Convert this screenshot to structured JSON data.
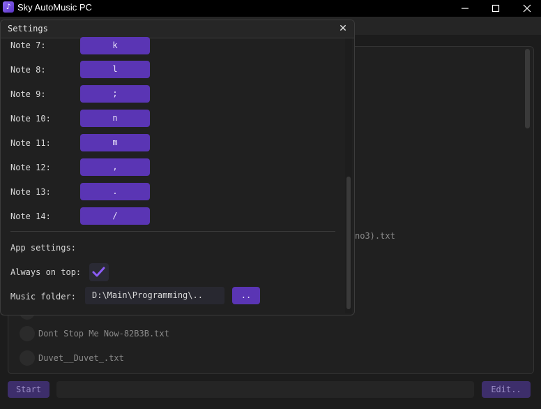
{
  "window": {
    "title": "Sky AutoMusic PC",
    "controls": [
      "minimize",
      "maximize",
      "close"
    ]
  },
  "background": {
    "partial_song_text": "no3).txt",
    "songs": [
      {
        "label": ""
      },
      {
        "label": "Dont Stop Me Now-82B3B.txt"
      },
      {
        "label": "Duvet__Duvet_.txt"
      }
    ],
    "start_label": "Start",
    "edit_label": "Edit.."
  },
  "settings": {
    "title": "Settings",
    "close_glyph": "✕",
    "notes": [
      {
        "label": "Note 7:",
        "key": "k"
      },
      {
        "label": "Note 8:",
        "key": "l"
      },
      {
        "label": "Note 9:",
        "key": ";"
      },
      {
        "label": "Note 10:",
        "key": "n"
      },
      {
        "label": "Note 11:",
        "key": "m"
      },
      {
        "label": "Note 12:",
        "key": ","
      },
      {
        "label": "Note 13:",
        "key": "."
      },
      {
        "label": "Note 14:",
        "key": "/"
      }
    ],
    "app_settings_label": "App settings:",
    "always_on_top_label": "Always on top:",
    "always_on_top_checked": true,
    "music_folder_label": "Music folder:",
    "music_folder_value": "D:\\Main\\Programming\\..",
    "browse_label": ".."
  },
  "colors": {
    "accent": "#5a35b4",
    "check": "#8b5cf6"
  }
}
